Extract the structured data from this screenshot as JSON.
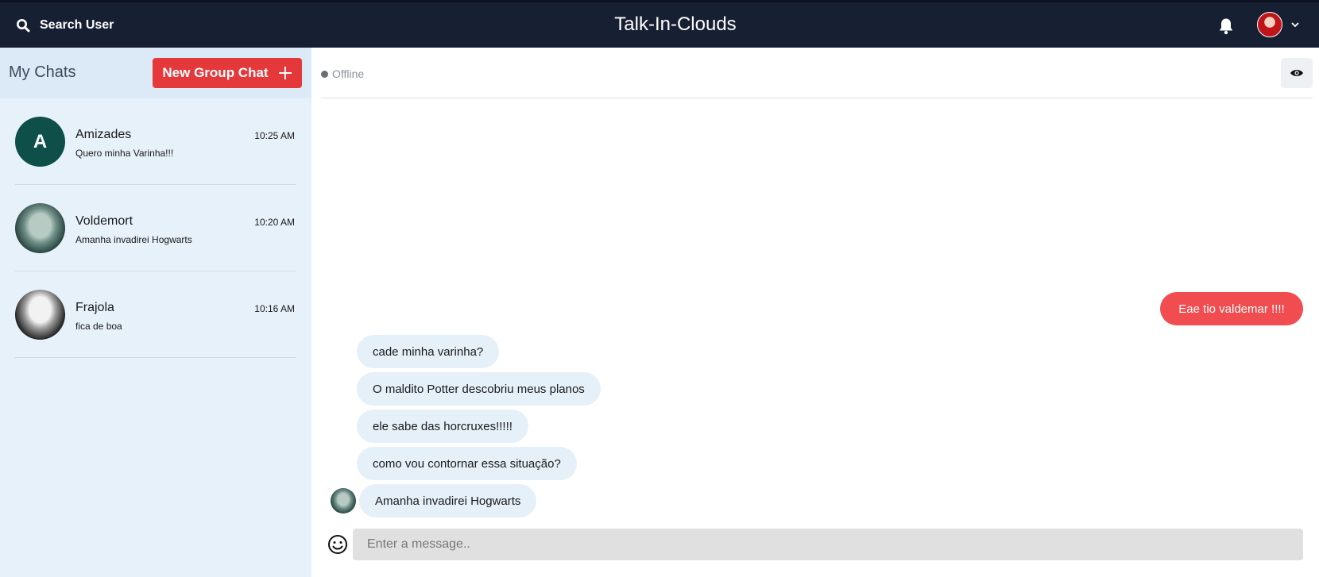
{
  "header": {
    "search_label": "Search User",
    "app_title": "Talk-In-Clouds"
  },
  "sidebar": {
    "title": "My Chats",
    "new_group_label": "New Group Chat",
    "chats": [
      {
        "name": "Amizades",
        "initial": "A",
        "preview": "Quero minha Varinha!!!",
        "time": "10:25 AM"
      },
      {
        "name": "Voldemort",
        "preview": "Amanha invadirei Hogwarts",
        "time": "10:20 AM"
      },
      {
        "name": "Frajola",
        "preview": "fica de boa",
        "time": "10:16 AM"
      }
    ]
  },
  "conversation": {
    "status": "Offline",
    "messages": [
      {
        "from": "me",
        "text": "Eae tio valdemar !!!!"
      },
      {
        "from": "other",
        "text": "cade minha varinha?"
      },
      {
        "from": "other",
        "text": "O maldito Potter descobriu meus planos"
      },
      {
        "from": "other",
        "text": "ele sabe das horcruxes!!!!!"
      },
      {
        "from": "other",
        "text": "como vou contornar essa situação?"
      },
      {
        "from": "other",
        "text": "Amanha invadirei Hogwarts"
      }
    ],
    "input_placeholder": "Enter a message..",
    "input_value": ""
  },
  "colors": {
    "topbar": "#172033",
    "accent_red": "#e5383b",
    "outgoing_bubble": "#f14c4f",
    "incoming_bubble": "#e6f0f8",
    "sidebar_bg": "#e7f1fa"
  },
  "icons": [
    "search-icon",
    "bell-icon",
    "avatar",
    "chevron-down-icon",
    "plus-icon",
    "eye-icon",
    "emoji-icon"
  ]
}
